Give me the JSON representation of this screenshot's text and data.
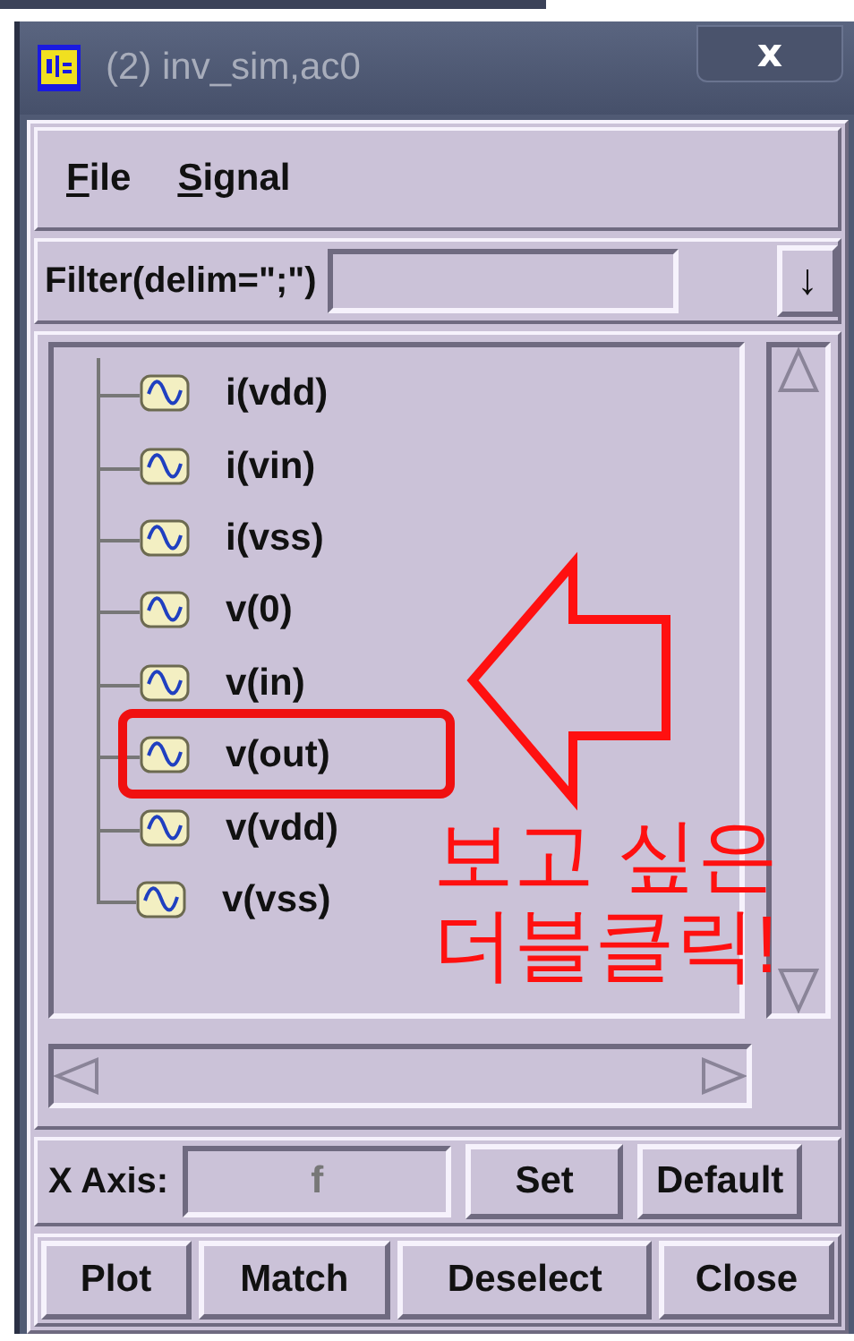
{
  "window": {
    "title": "(2) inv_sim,ac0",
    "close_glyph": "x"
  },
  "menu": [
    {
      "label": "File"
    },
    {
      "label": "Signal"
    }
  ],
  "filter": {
    "label": "Filter(delim=\";\")",
    "dropdown_glyph": "↓"
  },
  "signals": [
    {
      "name": "i(vdd)",
      "highlighted": false
    },
    {
      "name": "i(vin)",
      "highlighted": false
    },
    {
      "name": "i(vss)",
      "highlighted": false
    },
    {
      "name": "v(0)",
      "highlighted": false
    },
    {
      "name": "v(in)",
      "highlighted": false
    },
    {
      "name": "v(out)",
      "highlighted": true
    },
    {
      "name": "v(vdd)",
      "highlighted": false
    },
    {
      "name": "v(vss)",
      "highlighted": false
    }
  ],
  "x_axis": {
    "label": "X Axis:",
    "value": "f",
    "buttons": [
      "Set",
      "Default"
    ]
  },
  "buttons": [
    "Plot",
    "Match",
    "Deselect",
    "Close"
  ],
  "annotation": {
    "lines": [
      "보고 싶은",
      "더블클릭!"
    ]
  }
}
